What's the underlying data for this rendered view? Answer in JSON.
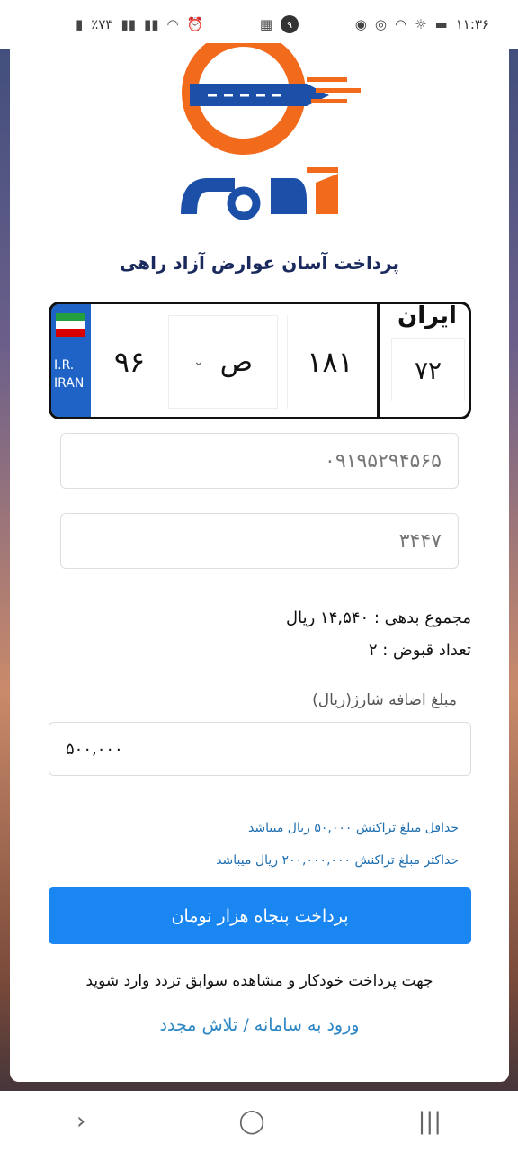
{
  "status_bar": {
    "left_text": "٪۷۳",
    "time": "۱۱:۳۶",
    "badge_count": "۹"
  },
  "page": {
    "tagline": "پرداخت آسان عوارض آزاد راهی"
  },
  "plate": {
    "country_code_line1": "I.R.",
    "country_code_line2": "IRAN",
    "number_left": "۹۶",
    "letter": "ص",
    "number_right": "۱۸۱",
    "iran_label": "ایران",
    "region_code": "۷۲"
  },
  "form": {
    "phone_value": "۰۹۱۹۵۲۹۴۵۶۵",
    "code_value": "۳۴۴۷",
    "total_debt": "مجموع بدهی : ۱۴,۵۴۰ ریال",
    "receipt_count": "تعداد قبوض : ۲",
    "charge_label": "مبلغ اضافه شارژ(ریال)",
    "charge_value": "۵۰۰,۰۰۰",
    "min_hint": "حداقل مبلغ تراکنش ۵۰,۰۰۰ ریال میباشد",
    "max_hint": "حداکثر مبلغ تراکنش ۲۰۰,۰۰۰,۰۰۰ ریال میباشد",
    "pay_button": "پرداخت پنجاه هزار تومان"
  },
  "footer": {
    "note": "جهت پرداخت خودکار و مشاهده سوابق تردد وارد شوید",
    "link": "ورود به سامانه / تلاش مجدد"
  },
  "nav": {
    "back": "›",
    "home": "◯",
    "recents": "|||"
  },
  "colors": {
    "brand_orange": "#f26a1b",
    "brand_blue": "#1c4fa8",
    "button_blue": "#1a86f2",
    "link_blue": "#2d86c4"
  }
}
